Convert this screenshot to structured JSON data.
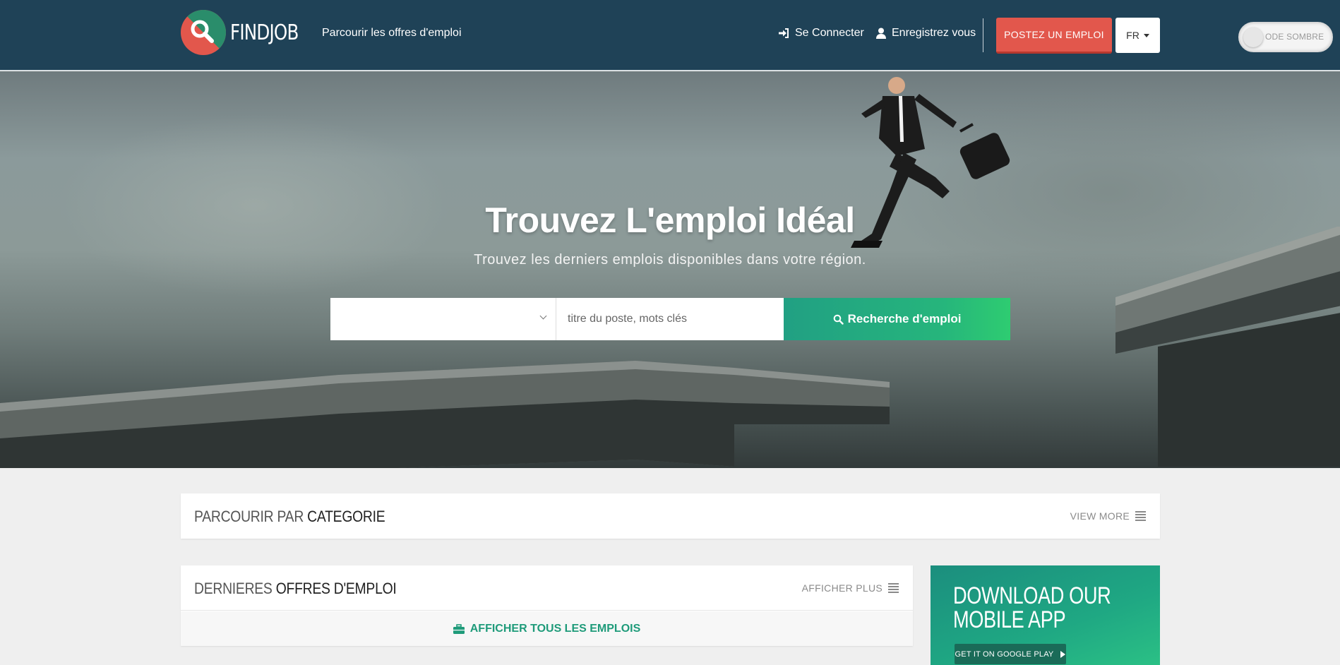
{
  "brand": {
    "name": "FINDJOB",
    "colors": {
      "primary": "#1f4257",
      "accent": "#e2574c",
      "green": "#26b57c"
    }
  },
  "header": {
    "browse_label": "Parcourir les offres d'emploi",
    "login_label": "Se Connecter",
    "register_label": "Enregistrez vous",
    "post_job_label": "POSTEZ UN EMPLOI",
    "language": "FR",
    "dark_mode_label": "ODE SOMBRE"
  },
  "hero": {
    "title": "Trouvez L'emploi Idéal",
    "subtitle": "Trouvez les derniers emplois disponibles dans votre région.",
    "search": {
      "location_value": "",
      "keyword_placeholder": "titre du poste, mots clés",
      "button_label": "Recherche d'emploi"
    }
  },
  "categories": {
    "title_light": "PARCOURIR PAR ",
    "title_strong": "CATEGORIE",
    "more_label": "VIEW MORE"
  },
  "latest_jobs": {
    "title_light": "DERNIERES ",
    "title_strong": "OFFRES D'EMPLOI",
    "more_label": "AFFICHER PLUS",
    "all_jobs_label": "AFFICHER TOUS LES EMPLOIS"
  },
  "app_promo": {
    "title_line1": "DOWNLOAD OUR",
    "title_line2": "MOBILE APP",
    "google_play_label": "GET IT ON GOOGLE PLAY"
  },
  "icons": [
    "search-icon",
    "login-icon",
    "user-icon",
    "chevron-down-icon",
    "bars-icon",
    "briefcase-icon",
    "play-icon"
  ]
}
